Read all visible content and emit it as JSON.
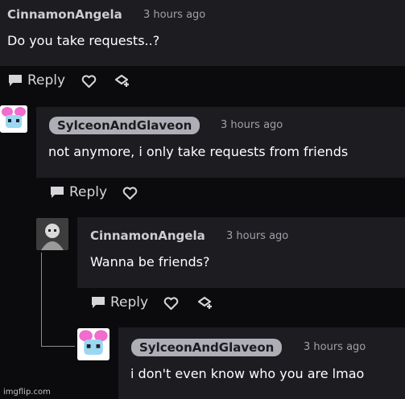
{
  "colors": {
    "background": "#0b0b0d",
    "card": "#1c1c21",
    "op_badge": "#aeaeb6",
    "text": "#ffffff",
    "muted": "#a0a0a6"
  },
  "comments": [
    {
      "username": "CinnamonAngela",
      "time": "3 hours ago",
      "text": "Do you take requests..?",
      "reply_label": "Reply",
      "icons": [
        "reply-bubble-icon",
        "heart-icon",
        "remix-icon"
      ]
    },
    {
      "username": "SylceonAndGlaveon",
      "time": "3 hours ago",
      "text": "not anymore, i only take requests from friends",
      "reply_label": "Reply",
      "icons": [
        "reply-bubble-icon",
        "heart-icon"
      ]
    },
    {
      "username": "CinnamonAngela",
      "time": "3 hours ago",
      "text": "Wanna be friends?",
      "reply_label": "Reply",
      "icons": [
        "reply-bubble-icon",
        "heart-icon",
        "remix-icon"
      ]
    },
    {
      "username": "SylceonAndGlaveon",
      "time": "3 hours ago",
      "text": "i don't even know who you are lmao"
    }
  ],
  "watermark": "imgflip.com"
}
